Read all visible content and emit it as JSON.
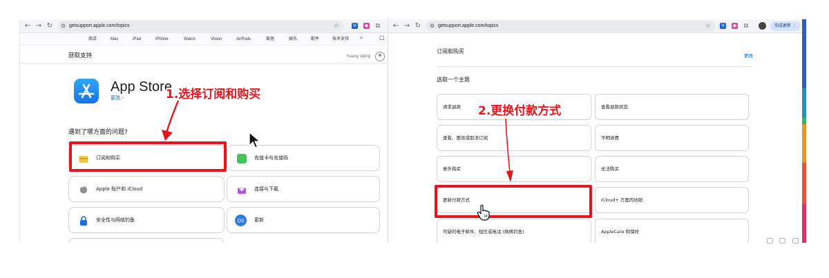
{
  "browser": {
    "url": "getsupport.apple.com/topics",
    "update_button": "完成更新"
  },
  "apple_nav": [
    "商店",
    "Mac",
    "iPad",
    "iPhone",
    "Watch",
    "Vision",
    "AirPods",
    "家居",
    "娱乐",
    "配件",
    "技术支持"
  ],
  "left": {
    "page_title": "获取支持",
    "user_name": "huang siping",
    "product_title": "App Store",
    "product_change": "更改 ›",
    "section_heading": "遇到了哪方面的问题?",
    "cards": [
      {
        "label": "订阅和购买",
        "icon": "card-icon"
      },
      {
        "label": "充值卡与充值码",
        "icon": "gift-card-icon"
      },
      {
        "label": "Apple 账户和 iCloud",
        "icon": "apple-icon"
      },
      {
        "label": "连接与下载",
        "icon": "download-icon"
      },
      {
        "label": "安全性与网络钓鱼",
        "icon": "lock-icon"
      },
      {
        "label": "更新",
        "icon": "macos-icon"
      }
    ]
  },
  "right": {
    "panel_heading": "订阅和购买",
    "panel_change": "更改",
    "topic_heading": "选取一个主题",
    "topics": [
      "请求退款",
      "查看退款状态",
      "查看、更改或取消订阅",
      "不明收费",
      "意外购买",
      "无法购买",
      "更新付款方式",
      "iCloud+ 方面的协助",
      "可疑的电子邮件、短信或电话 (网络钓鱼)",
      "AppleCare 和保修"
    ]
  },
  "annotations": {
    "step1": "1.选择订阅和购买",
    "step2": "2.更换付款方式"
  },
  "colors": {
    "highlight": "#e5151f",
    "link": "#0066cc",
    "side_bar": [
      "#2f5fb0",
      "#2a8fb8",
      "#37b07d",
      "#e09a2a",
      "#e4573a",
      "#d8336e"
    ]
  }
}
